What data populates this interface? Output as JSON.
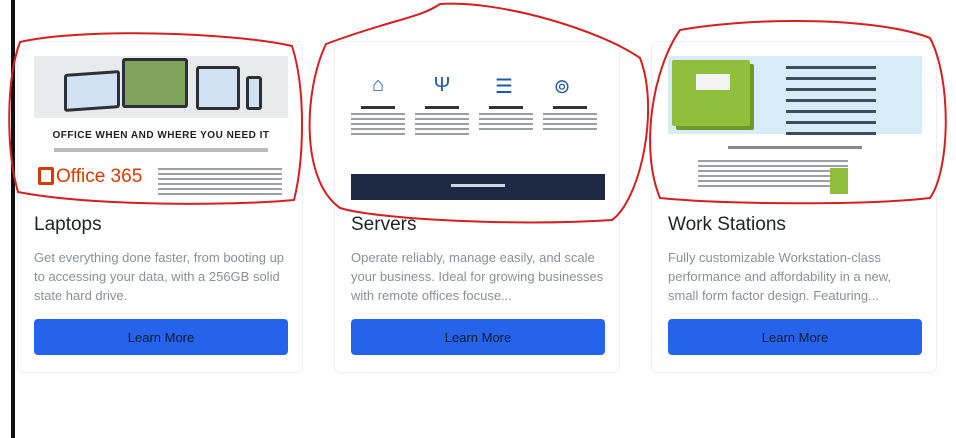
{
  "cards": [
    {
      "title": "Laptops",
      "description": "Get everything done faster, from booting up to accessing your data, with a 256GB solid state hard drive.",
      "button_label": "Learn More",
      "image": {
        "heading": "OFFICE WHEN AND WHERE YOU NEED IT",
        "logo_text": "Office 365"
      }
    },
    {
      "title": "Servers",
      "description": "Operate reliably, manage easily, and scale your business. Ideal for growing businesses with remote offices focuse...",
      "button_label": "Learn More"
    },
    {
      "title": "Work Stations",
      "description": "Fully customizable Workstation-class performance and affordability in a new, small form factor design. Featuring...",
      "button_label": "Learn More"
    }
  ],
  "colors": {
    "button": "#2563eb",
    "annotation": "#d42020"
  }
}
